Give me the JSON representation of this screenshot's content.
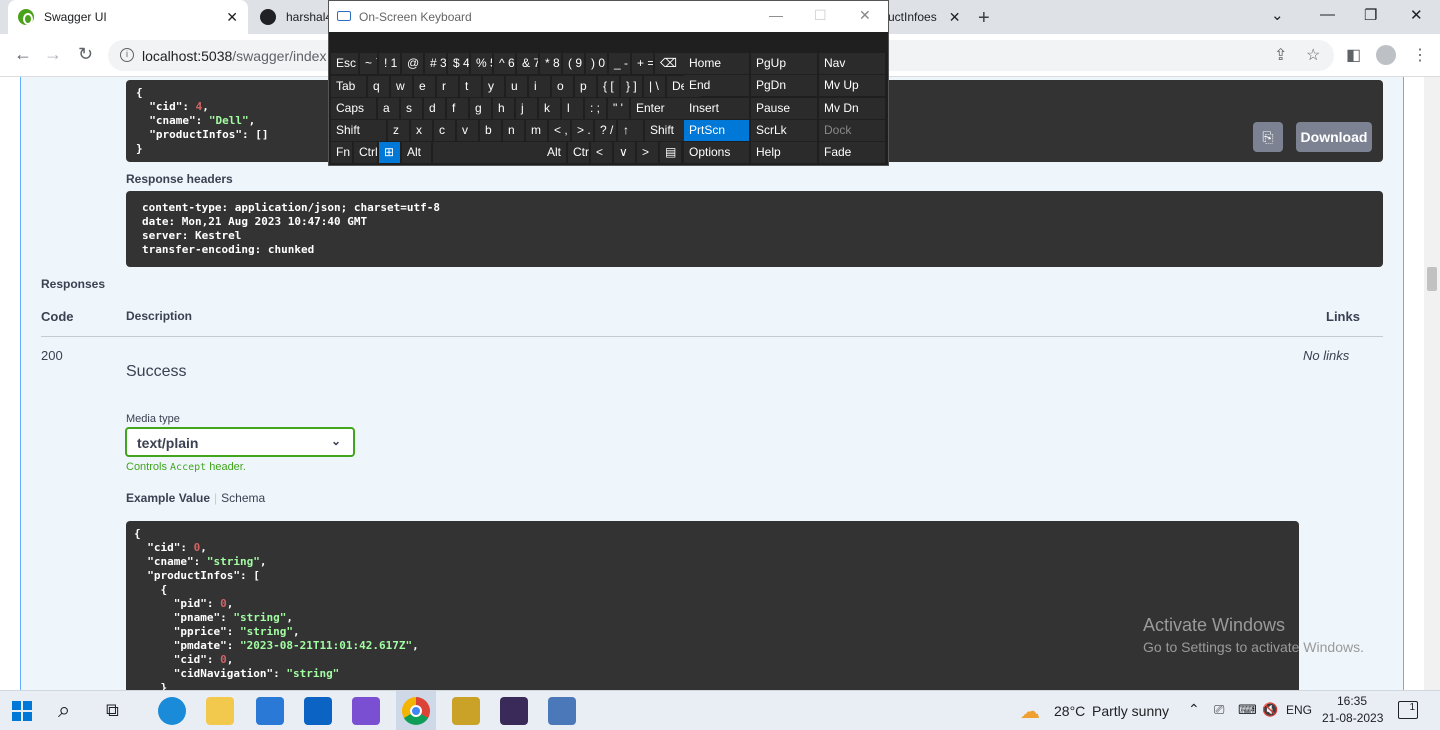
{
  "browser": {
    "tabs": [
      {
        "title": "Swagger UI",
        "close": "✕"
      },
      {
        "title": "harshal4"
      },
      {
        "title": "uctInfoes",
        "close": "✕"
      }
    ],
    "new_tab": "+",
    "url_host": "localhost:5038",
    "url_path": "/swagger/index"
  },
  "osk": {
    "title": "On-Screen Keyboard",
    "rows": [
      [
        "Esc",
        "~ `",
        "! 1",
        "@ 2",
        "# 3",
        "$ 4",
        "% 5",
        "^ 6",
        "& 7",
        "* 8",
        "( 9",
        ") 0",
        "_ -",
        "+ =",
        "⌫"
      ],
      [
        "Tab",
        "q",
        "w",
        "e",
        "r",
        "t",
        "y",
        "u",
        "i",
        "o",
        "p",
        "{ [",
        "} ]",
        "| \\",
        "Del"
      ],
      [
        "Caps",
        "a",
        "s",
        "d",
        "f",
        "g",
        "h",
        "j",
        "k",
        "l",
        ": ;",
        "\" '",
        "Enter"
      ],
      [
        "Shift",
        "z",
        "x",
        "c",
        "v",
        "b",
        "n",
        "m",
        "< ,",
        "> .",
        "? /",
        "↑",
        "Shift"
      ],
      [
        "Fn",
        "Ctrl",
        "⊞",
        "Alt",
        "Alt",
        "Ctrl",
        "<",
        "∨",
        ">",
        "▤"
      ]
    ],
    "side_col1": [
      "Home",
      "End",
      "Insert",
      "PrtScn",
      "Options"
    ],
    "side_col2": [
      "PgUp",
      "PgDn",
      "Pause",
      "ScrLk",
      "Help"
    ],
    "side_col3": [
      "Nav",
      "Mv Up",
      "Mv Dn",
      "Dock",
      "Fade"
    ]
  },
  "response_body": {
    "lines": [
      {
        "t": "{"
      },
      {
        "k": "  \"cid\": ",
        "v": "4",
        "vt": "num",
        "e": ","
      },
      {
        "k": "  \"cname\": ",
        "v": "\"Dell\"",
        "vt": "str",
        "e": ","
      },
      {
        "k": "  \"productInfos\": []"
      },
      {
        "t": "}"
      }
    ],
    "download_label": "Download"
  },
  "response_headers": {
    "label": "Response headers",
    "lines": [
      "content-type: application/json; charset=utf-8",
      "date: Mon,21 Aug 2023 10:47:40 GMT",
      "server: Kestrel",
      "transfer-encoding: chunked"
    ]
  },
  "responses": {
    "label": "Responses",
    "col_code": "Code",
    "col_description": "Description",
    "col_links": "Links",
    "code": "200",
    "description": "Success",
    "links": "No links",
    "media_type_label": "Media type",
    "media_type_value": "text/plain",
    "controls_pre": "Controls ",
    "controls_code": "Accept",
    "controls_post": " header.",
    "example_value_label": "Example Value",
    "schema_label": "Schema"
  },
  "example": {
    "lines": [
      {
        "t": "{"
      },
      {
        "k": "  \"cid\": ",
        "v": "0",
        "vt": "num",
        "e": ","
      },
      {
        "k": "  \"cname\": ",
        "v": "\"string\"",
        "vt": "str",
        "e": ","
      },
      {
        "k": "  \"productInfos\": ["
      },
      {
        "t": "    {"
      },
      {
        "k": "      \"pid\": ",
        "v": "0",
        "vt": "num",
        "e": ","
      },
      {
        "k": "      \"pname\": ",
        "v": "\"string\"",
        "vt": "str",
        "e": ","
      },
      {
        "k": "      \"pprice\": ",
        "v": "\"string\"",
        "vt": "str",
        "e": ","
      },
      {
        "k": "      \"pmdate\": ",
        "v": "\"2023-08-21T11:01:42.617Z\"",
        "vt": "str",
        "e": ","
      },
      {
        "k": "      \"cid\": ",
        "v": "0",
        "vt": "num",
        "e": ","
      },
      {
        "k": "      \"cidNavigation\": ",
        "v": "\"string\"",
        "vt": "str"
      },
      {
        "t": "    }"
      }
    ]
  },
  "watermark": {
    "line1": "Activate Windows",
    "line2": "Go to Settings to activate Windows."
  },
  "taskbar": {
    "weather_temp": "28°C",
    "weather_desc": "Partly sunny",
    "lang": "ENG",
    "time": "16:35",
    "date": "21-08-2023",
    "notif_count": "1"
  }
}
